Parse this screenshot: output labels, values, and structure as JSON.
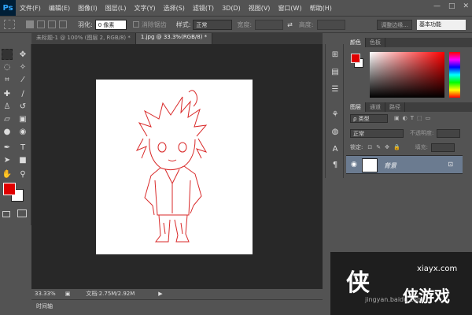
{
  "app": {
    "logo": "Ps"
  },
  "menu": [
    "文件(F)",
    "编辑(E)",
    "图像(I)",
    "图层(L)",
    "文字(Y)",
    "选择(S)",
    "滤镜(T)",
    "3D(D)",
    "视图(V)",
    "窗口(W)",
    "帮助(H)"
  ],
  "window_controls": {
    "minimize": "—",
    "maximize": "□",
    "close": "✕"
  },
  "options_bar": {
    "feather_label": "羽化:",
    "feather_value": "0 像素",
    "antialias_label": "消除锯齿",
    "style_label": "样式:",
    "style_value": "正常",
    "width_label": "宽度:",
    "height_label": "高度:",
    "refine_edge": "调整边缘...",
    "workspace": "基本功能"
  },
  "tabs": [
    {
      "label": "未标题-1 @ 100% (图层 2, RGB/8) *"
    },
    {
      "label": "1.jpg @ 33.3%(RGB/8) *"
    }
  ],
  "status": {
    "zoom": "33.33%",
    "doc": "文档:2.75M/2.92M"
  },
  "timeline": {
    "label": "时间轴"
  },
  "color_panel": {
    "tabs": [
      "颜色",
      "色板"
    ],
    "foreground": "#e00000",
    "background": "#ffffff"
  },
  "layers_panel": {
    "tabs": [
      "图层",
      "通道",
      "路径"
    ],
    "kind_label": "ρ 类型",
    "blend_mode": "正常",
    "opacity_label": "不透明度:",
    "lock_label": "锁定:",
    "fill_label": "填充:",
    "layer_name": "背景"
  },
  "watermark": {
    "text1": "xiayx.com",
    "text2": "侠游戏",
    "text3": "jingyan.baidu.com"
  }
}
